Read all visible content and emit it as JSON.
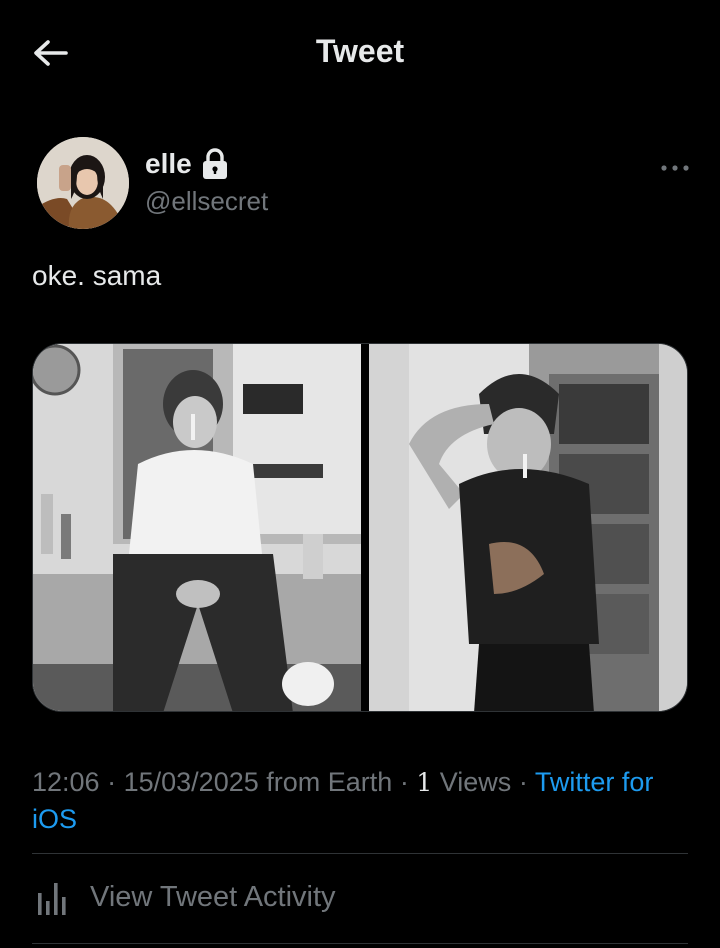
{
  "header": {
    "title": "Tweet",
    "back_icon": "arrow-left-icon"
  },
  "author": {
    "display_name": "elle",
    "handle": "@ellsecret",
    "protected_icon": "lock-icon",
    "more_icon": "more-horizontal-icon"
  },
  "tweet": {
    "text": "oke. sama",
    "media_count": 2
  },
  "meta": {
    "time": "12:06",
    "date": "15/03/2025",
    "location": "from Earth",
    "views_count": "1",
    "views_label": "Views",
    "source": "Twitter for iOS",
    "separator": "·"
  },
  "activity": {
    "label": "View Tweet Activity",
    "icon": "bar-chart-icon"
  },
  "colors": {
    "background": "#000000",
    "text_primary": "#e7e9ea",
    "text_secondary": "#71767b",
    "link": "#1d9bf0",
    "divider": "#2f3336"
  }
}
